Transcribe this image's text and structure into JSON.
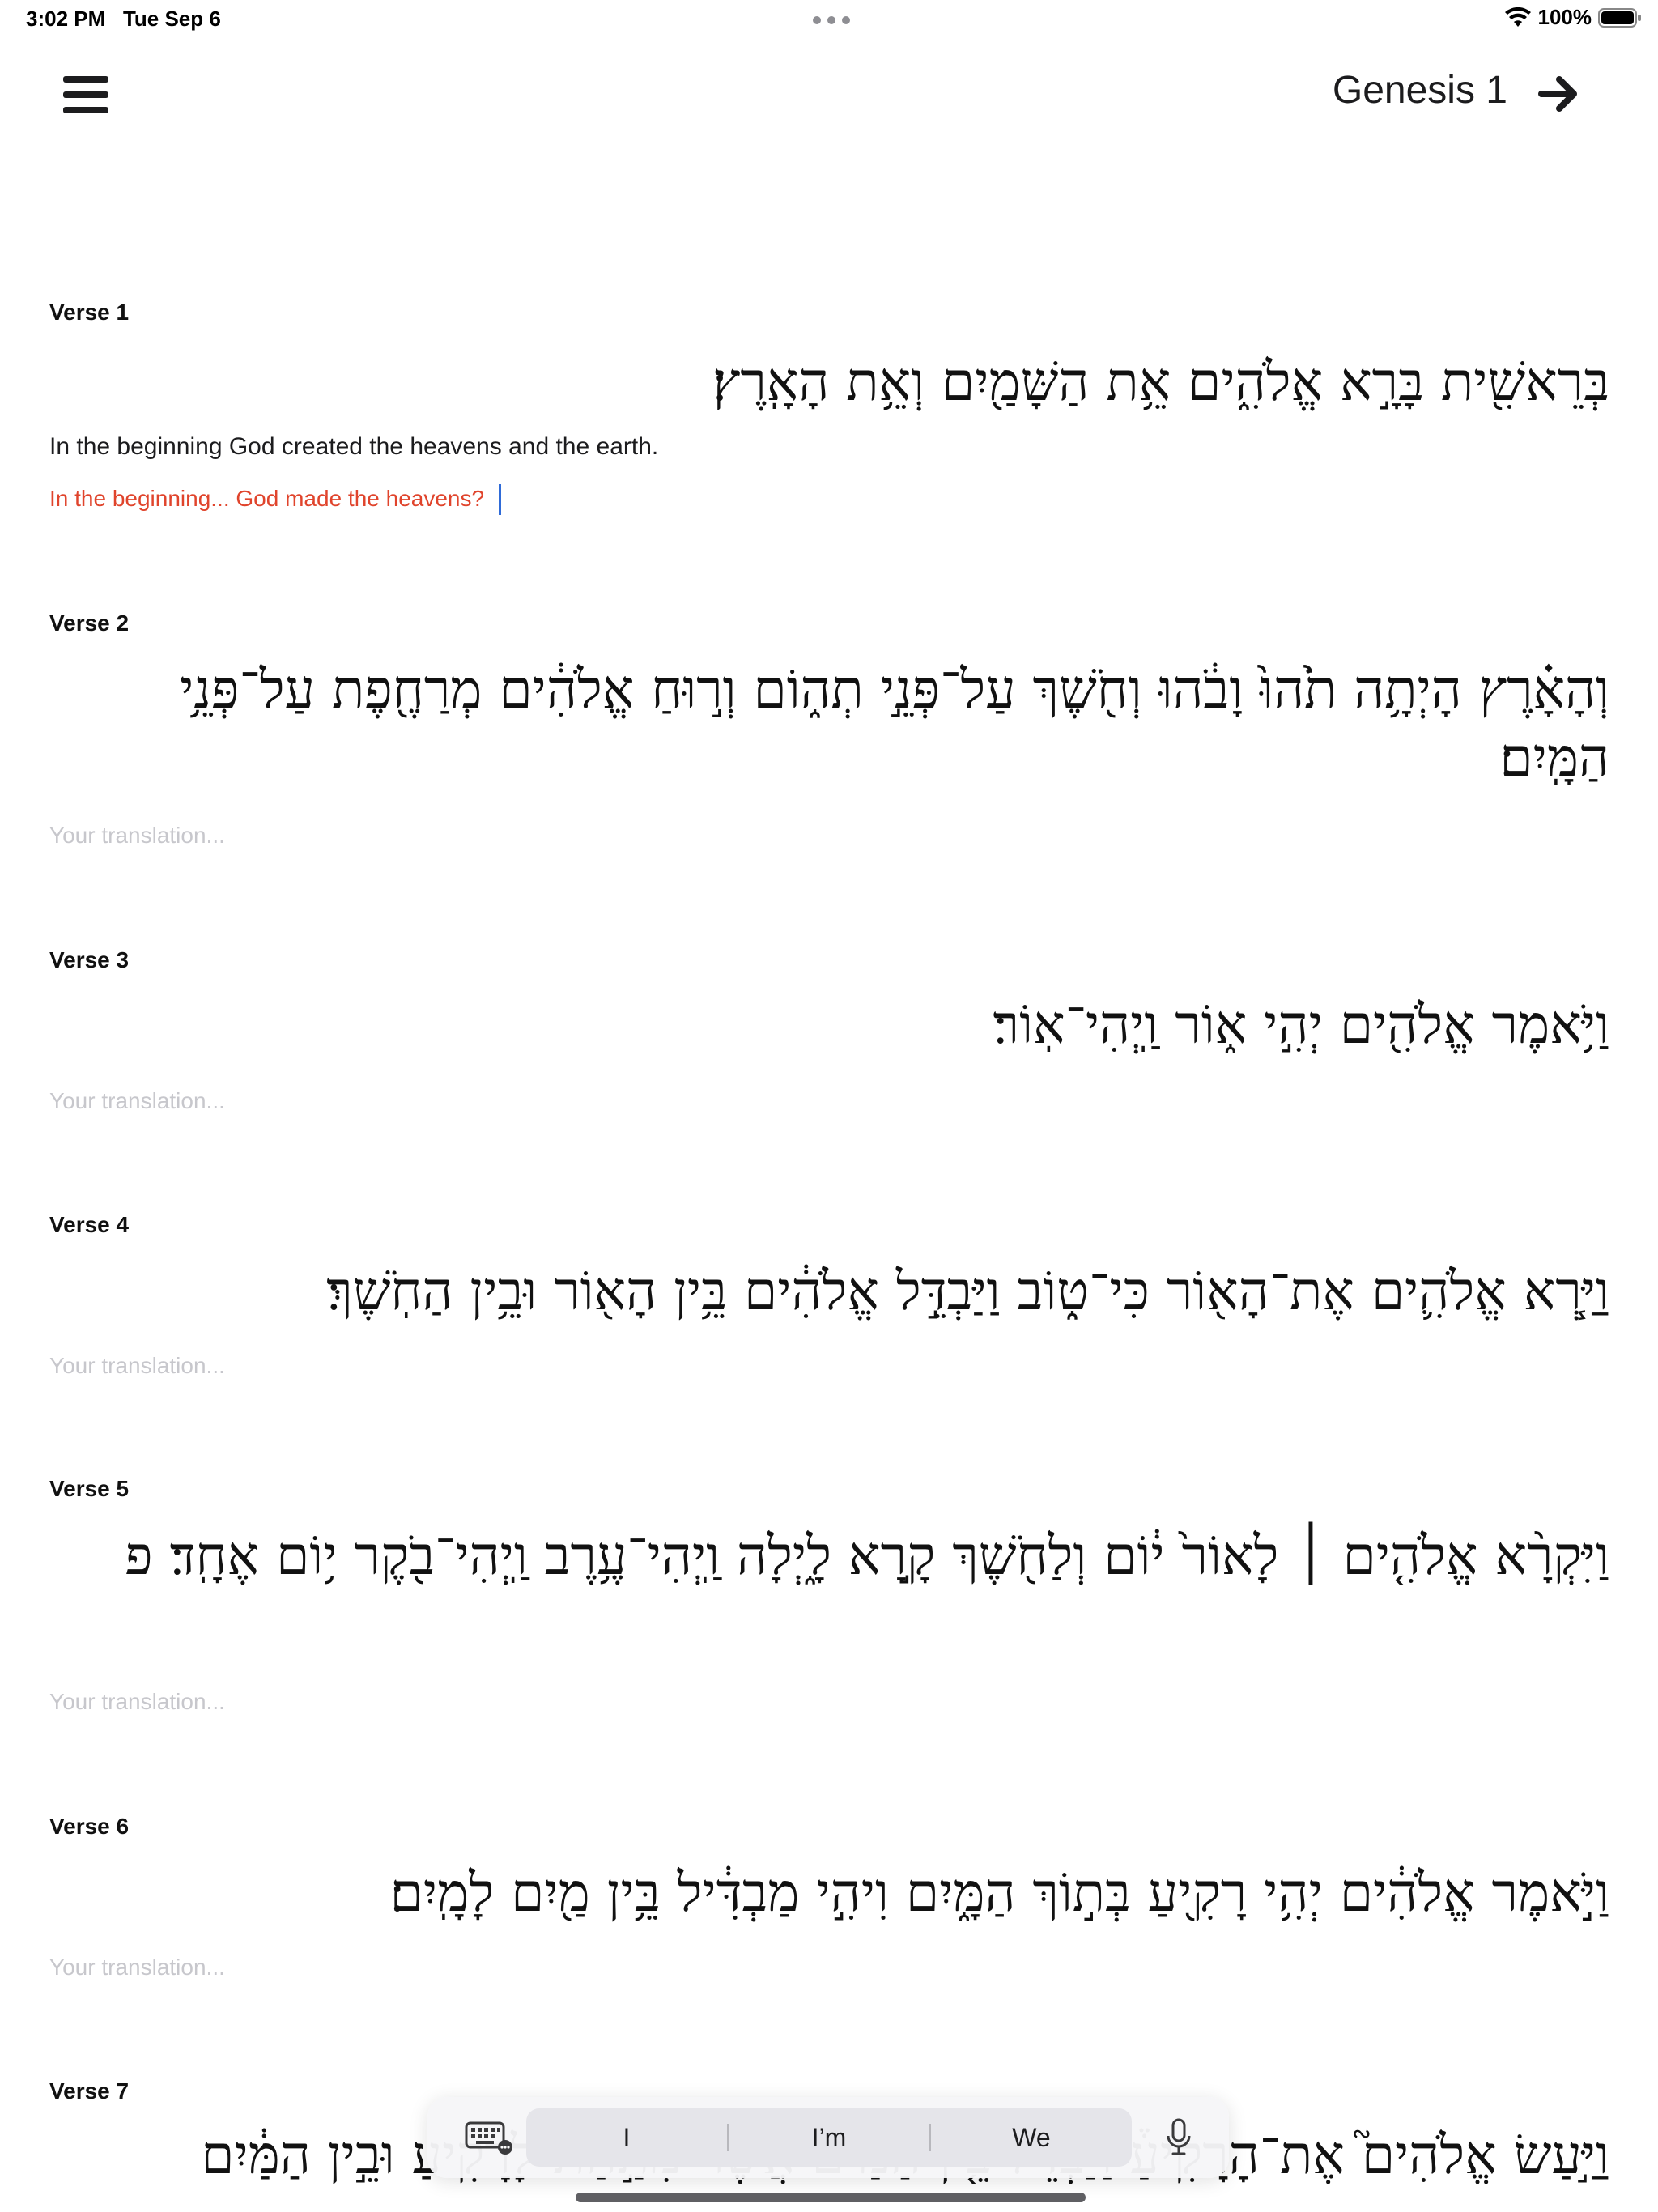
{
  "status_bar": {
    "time": "3:02 PM",
    "date": "Tue Sep 6",
    "battery_pct": "100%"
  },
  "nav": {
    "chapter_title": "Genesis 1"
  },
  "verses": [
    {
      "label": "Verse 1",
      "hebrew": "בְּרֵאשִׁ֖ית בָּרָ֣א אֱלֹהִ֑ים אֵ֥ת הַשָּׁמַ֖יִם וְאֵ֥ת הָאָֽרֶץ׃",
      "english": "In the beginning God created the heavens and the earth.",
      "translation": "In the beginning... God made the heavens?",
      "placeholder": "Your translation..."
    },
    {
      "label": "Verse 2",
      "hebrew": "וְהָאָ֗רֶץ הָיְתָ֥ה תֹ֙הוּ֙ וָבֹ֔הוּ וְחֹ֖שֶׁךְ עַל־פְּנֵ֣י תְה֑וֹם וְר֣וּחַ אֱלֹהִ֔ים מְרַחֶ֖פֶת עַל־פְּנֵ֥י הַמָּֽיִם׃",
      "english": "",
      "translation": "",
      "placeholder": "Your translation..."
    },
    {
      "label": "Verse 3",
      "hebrew": "וַיֹּ֥אמֶר אֱלֹהִ֖ים יְהִ֣י א֑וֹר וַֽיְהִי־אֽוֹר׃",
      "english": "",
      "translation": "",
      "placeholder": "Your translation..."
    },
    {
      "label": "Verse 4",
      "hebrew": "וַיַּ֧רְא אֱלֹהִ֛ים אֶת־הָא֖וֹר כִּי־ט֑וֹב וַיַּבְדֵּ֣ל אֱלֹהִ֔ים בֵּ֥ין הָא֖וֹר וּבֵ֥ין הַחֹֽשֶׁךְ׃",
      "english": "",
      "translation": "",
      "placeholder": "Your translation..."
    },
    {
      "label": "Verse 5",
      "hebrew": "וַיִּקְרָ֨א אֱלֹהִ֤ים ׀ לָאוֹר֙ י֔וֹם וְלַחֹ֖שֶׁךְ קָ֣רָא לָ֑יְלָה וַֽיְהִי־עֶ֥רֶב וַֽיְהִי־בֹ֖קֶר י֥וֹם אֶחָֽד׃ פ",
      "english": "",
      "translation": "",
      "placeholder": "Your translation..."
    },
    {
      "label": "Verse 6",
      "hebrew": "וַיֹּ֣אמֶר אֱלֹהִ֔ים יְהִ֥י רָקִ֖יעַ בְּת֣וֹךְ הַמָּ֑יִם וִיהִ֣י מַבְדִּ֔יל בֵּ֥ין מַ֖יִם לָמָֽיִם׃",
      "english": "",
      "translation": "",
      "placeholder": "Your translation..."
    },
    {
      "label": "Verse 7",
      "hebrew": "וַיַּ֣עַשׂ אֱלֹהִים֮ אֶת־הָרָקִיעַ֒ וַיַּבְדֵּ֗ל בֵּ֤ין הַמַּ֙יִם֙ אֲשֶׁר֙ מִתַּ֣חַת לָרָקִ֔יעַ וּבֵ֣ין הַמַּ֔יִם",
      "english": "",
      "translation": "",
      "placeholder": "Your translation..."
    }
  ],
  "keyboard": {
    "suggestions": [
      "I",
      "I’m",
      "We"
    ]
  }
}
